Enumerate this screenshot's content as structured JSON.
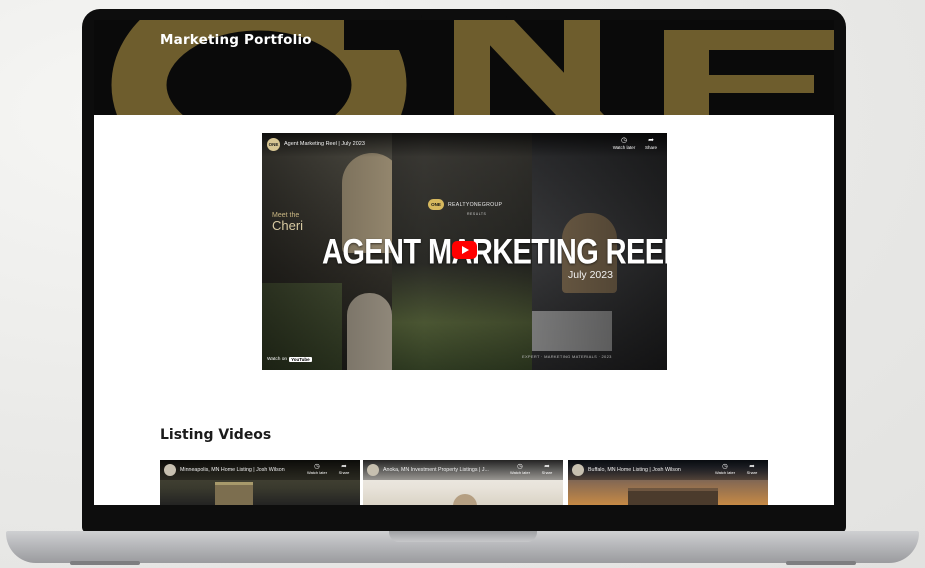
{
  "page": {
    "title": "Marketing Portfolio",
    "hero_letters": "ONE",
    "colors": {
      "gold": "#6e5d2d",
      "dark": "#0a0a0a",
      "youtube_red": "#ff0000"
    }
  },
  "reel": {
    "channel_avatar": "ONE",
    "video_title": "Agent Marketing Reel | July 2023",
    "watch_later": "Watch later",
    "share": "Share",
    "brand_badge": "ONE",
    "brand_name": "REALTYONEGROUP",
    "brand_sub": "RESULTS",
    "headline": "AGENT MARKETING REEL",
    "date": "July 2023",
    "side_label": "Meet the",
    "side_name": "Cheri",
    "watch_on": "Watch on",
    "youtube": "YouTube",
    "caption": "EXPERT · MARKETING MATERIALS · 2023"
  },
  "listing": {
    "heading": "Listing Videos",
    "videos": [
      {
        "title": "Minneapolis, MN Home Listing | Josh Wilson",
        "watch_later": "Watch later",
        "share": "Share"
      },
      {
        "title": "Anoka, MN Investment Property Listings | J...",
        "watch_later": "Watch later",
        "share": "Share"
      },
      {
        "title": "Buffalo, MN Home Listing | Josh Wilson",
        "watch_later": "Watch later",
        "share": "Share"
      }
    ]
  }
}
